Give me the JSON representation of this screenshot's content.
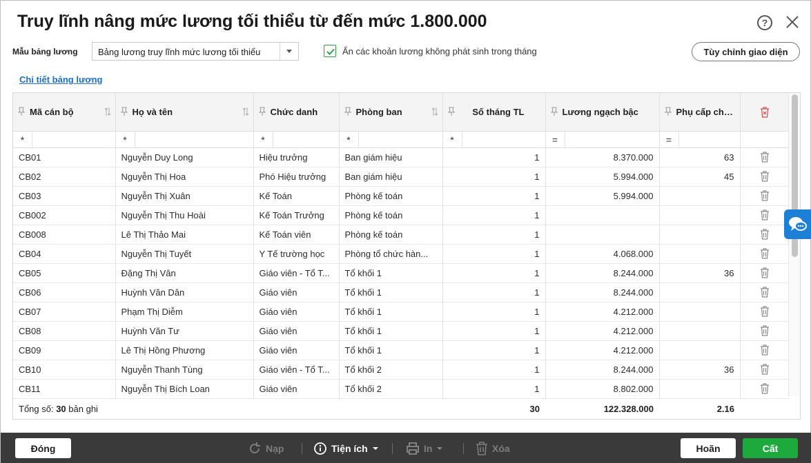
{
  "dialog": {
    "title": "Truy lĩnh nâng mức lương tối thiểu từ đến mức 1.800.000",
    "help_label": "?"
  },
  "toolbar": {
    "template_label": "Mẫu bảng lương",
    "template_value": "Bảng lương truy lĩnh mức lương tối thiểu",
    "hide_checkbox_label": "Ẩn các khoản lương không phát sinh trong tháng",
    "hide_checked": true,
    "customize_label": "Tùy chỉnh giao diện"
  },
  "detail_link": "Chi tiết bảng lương",
  "table": {
    "columns": [
      {
        "label": "Mã cán bộ",
        "filter": "*"
      },
      {
        "label": "Họ và tên",
        "filter": "*"
      },
      {
        "label": "Chức danh",
        "filter": "*"
      },
      {
        "label": "Phòng ban",
        "filter": "*"
      },
      {
        "label": "Số tháng TL",
        "filter": "*"
      },
      {
        "label": "Lương ngạch bậc",
        "filter": "="
      },
      {
        "label": "Phụ cấp chức vụ",
        "filter": "="
      }
    ],
    "rows": [
      [
        "CB01",
        "Nguyễn Duy Long",
        "Hiệu trưởng",
        "Ban giám hiệu",
        "1",
        "8.370.000",
        "63"
      ],
      [
        "CB02",
        "Nguyễn Thị Hoa",
        "Phó Hiệu trưởng",
        "Ban giám hiệu",
        "1",
        "5.994.000",
        "45"
      ],
      [
        "CB03",
        "Nguyễn Thị Xuân",
        "Kế Toán",
        "Phòng kế toán",
        "1",
        "5.994.000",
        ""
      ],
      [
        "CB002",
        "Nguyễn Thị Thu Hoài",
        "Kế Toán Trưởng",
        "Phòng kế toán",
        "1",
        "",
        ""
      ],
      [
        "CB008",
        "Lê Thị Thảo Mai",
        "Kế Toán viên",
        "Phòng kế toán",
        "1",
        "",
        ""
      ],
      [
        "CB04",
        "Nguyễn Thị Tuyết",
        "Y Tế trường học",
        "Phòng tổ chức hàn...",
        "1",
        "4.068.000",
        ""
      ],
      [
        "CB05",
        "Đặng Thị Vân",
        "Giáo viên - Tổ T...",
        "Tổ khối 1",
        "1",
        "8.244.000",
        "36"
      ],
      [
        "CB06",
        "Huỳnh Văn Dân",
        "Giáo viên",
        "Tổ khối 1",
        "1",
        "8.244.000",
        ""
      ],
      [
        "CB07",
        "Phạm Thị Diễm",
        "Giáo viên",
        "Tổ khối 1",
        "1",
        "4.212.000",
        ""
      ],
      [
        "CB08",
        "Huỳnh Văn Tư",
        "Giáo viên",
        "Tổ khối 1",
        "1",
        "4.212.000",
        ""
      ],
      [
        "CB09",
        "Lê Thị Hồng Phương",
        "Giáo viên",
        "Tổ khối 1",
        "1",
        "4.212.000",
        ""
      ],
      [
        "CB10",
        "Nguyễn Thanh Tùng",
        "Giáo viên - Tổ T...",
        "Tổ khối 2",
        "1",
        "8.244.000",
        "36"
      ],
      [
        "CB11",
        "Nguyễn Thị Bích Loan",
        "Giáo viên",
        "Tổ khối 2",
        "1",
        "8.802.000",
        ""
      ]
    ],
    "summary": {
      "prefix": "Tổng số: ",
      "count": "30",
      "suffix": " bản ghi",
      "months_total": "30",
      "salary_total": "122.328.000",
      "allowance_total": "2.16"
    }
  },
  "footer": {
    "close": "Đóng",
    "reload": "Nạp",
    "utilities": "Tiện ích",
    "print": "In",
    "delete": "Xóa",
    "done": "Hoãn",
    "save": "Cất"
  },
  "colors": {
    "accent_green": "#1da93c",
    "link_blue": "#1c6fc0",
    "footer_bg": "#3a3a3a",
    "chat_blue": "#1d7fd6"
  },
  "icons": [
    "help-icon",
    "close-icon",
    "check-icon",
    "dropdown-arrow-icon",
    "pin-icon",
    "sort-icon",
    "trash-icon",
    "reload-icon",
    "info-icon",
    "print-icon",
    "chat-icon"
  ]
}
